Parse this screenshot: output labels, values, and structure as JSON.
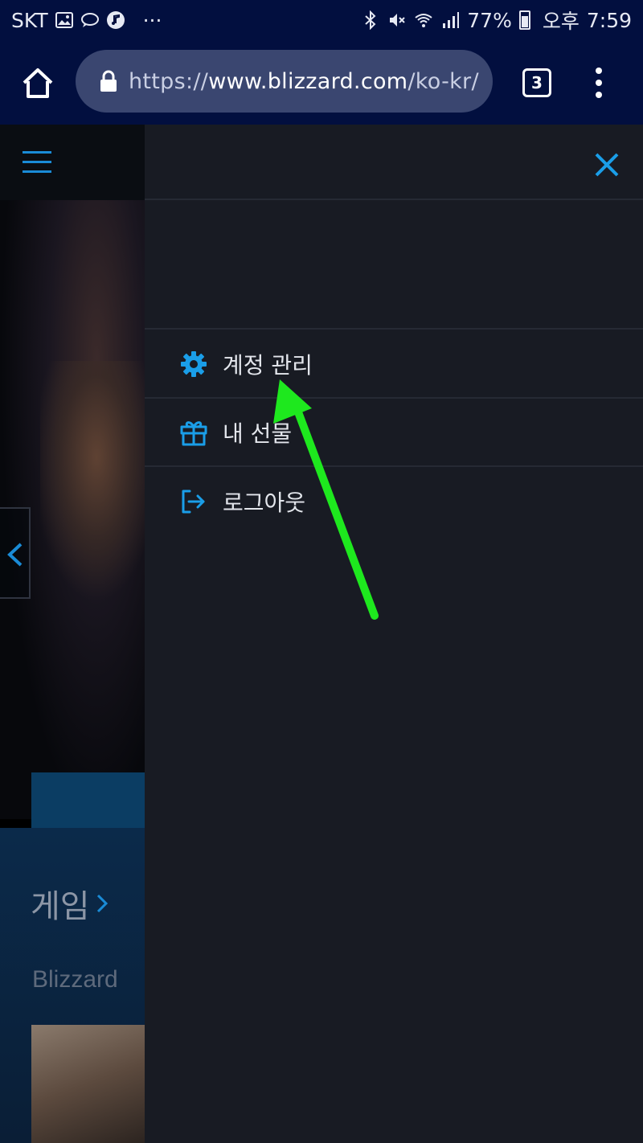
{
  "status_bar": {
    "carrier": "SKT",
    "more": "···",
    "battery": "77%",
    "ampm": "오후",
    "time": "7:59"
  },
  "browser": {
    "url_scheme": "https://",
    "url_host": "www.blizzard.com",
    "url_path": "/ko-kr/",
    "tab_count": "3"
  },
  "drawer": {
    "menu": [
      {
        "label": "계정 관리",
        "icon": "gear-icon"
      },
      {
        "label": "내 선물",
        "icon": "gift-icon"
      },
      {
        "label": "로그아웃",
        "icon": "logout-icon"
      }
    ]
  },
  "page": {
    "games_title": "게임",
    "games_subtitle": "Blizzard"
  },
  "colors": {
    "accent": "#1a9ee8",
    "status_bg": "#020f3f",
    "drawer_bg": "#181b23",
    "arrow": "#1ee81e"
  }
}
